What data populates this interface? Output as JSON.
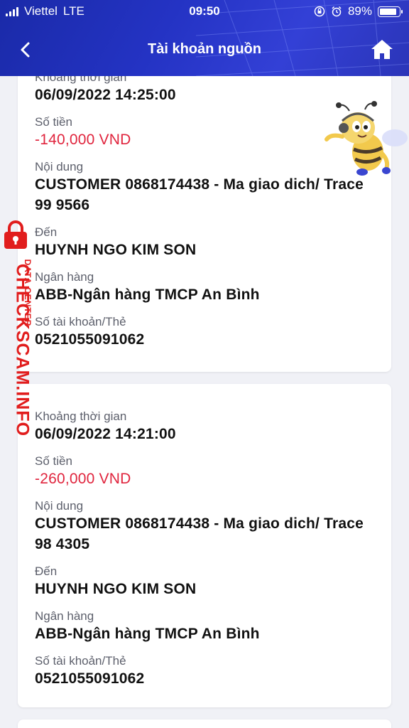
{
  "status_bar": {
    "carrier": "Viettel",
    "network": "LTE",
    "time": "09:50",
    "battery": "89%",
    "battery_level": 0.89
  },
  "header": {
    "title": "Tài khoản nguồn",
    "back_icon": "chevron-left-icon",
    "home_icon": "home-icon",
    "background_color": "#2433c4"
  },
  "transactions": [
    {
      "time_label": "Khoảng thời gian",
      "time": "06/09/2022 14:25:00",
      "amount_label": "Số tiền",
      "amount": "-140,000 VND",
      "content_label": "Nội dung",
      "content": "CUSTOMER 0868174438 - Ma giao dich/ Trace 99 9566",
      "to_label": "Đến",
      "to": "HUYNH NGO KIM SON",
      "bank_label": "Ngân hàng",
      "bank": "ABB-Ngân hàng TMCP An Bình",
      "account_label": "Số tài khoản/Thẻ",
      "account": "0521055091062"
    },
    {
      "time_label": "Khoảng thời gian",
      "time": "06/09/2022 14:21:00",
      "amount_label": "Số tiền",
      "amount": "-260,000 VND",
      "content_label": "Nội dung",
      "content": "CUSTOMER 0868174438 - Ma giao dich/ Trace 98 4305",
      "to_label": "Đến",
      "to": "HUYNH NGO KIM SON",
      "bank_label": "Ngân hàng",
      "bank": "ABB-Ngân hàng TMCP An Bình",
      "account_label": "Số tài khoản/Thẻ",
      "account": "0521055091062"
    }
  ],
  "watermark": {
    "brand": "CHECKSCAM.INFO",
    "sub": "DATA CENTER",
    "color": "#e11d1d"
  },
  "colors": {
    "negative_amount": "#e0243d"
  }
}
